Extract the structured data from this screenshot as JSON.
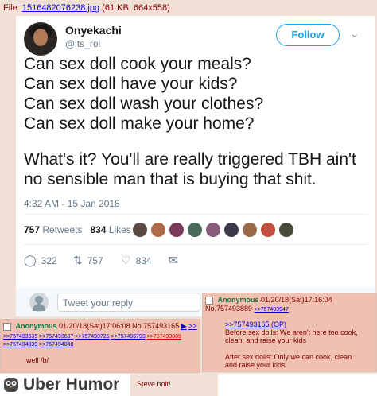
{
  "file_bar": {
    "prefix": "File:",
    "filename": "1516482076238.jpg",
    "info": "(61 KB, 664x558)"
  },
  "tweet": {
    "display_name": "Onyekachi",
    "handle": "@its_roi",
    "follow_label": "Follow",
    "lines": [
      "Can sex doll cook your meals?",
      "Can sex doll have your kids?",
      "Can sex doll wash your clothes?",
      "Can sex doll make your home?"
    ],
    "second_paragraph": "What's it? You'll are really triggered TBH ain't no sensible man that is buying that shit.",
    "timestamp": "4:32 AM - 15 Jan 2018",
    "retweets_count": "757",
    "retweets_label": "Retweets",
    "likes_count": "834",
    "likes_label": "Likes",
    "liker_avatar_colors": [
      "#5a4a42",
      "#b06a4a",
      "#7a3a5a",
      "#4a6a5a",
      "#8a5a7a",
      "#3a3a4a",
      "#9a6a4a",
      "#c05040",
      "#4a4a3a"
    ],
    "actions": {
      "reply_count": "322",
      "retweet_count": "757",
      "like_count": "834"
    },
    "reply_placeholder": "Tweet your reply"
  },
  "posts": [
    {
      "name": "Anonymous",
      "datetime": "01/20/18(Sat)17:06:08",
      "number": "No.757493165",
      "arrow": "▶",
      "backlink_first": ">>",
      "backlinks": [
        ">>757493635",
        ">>757493697",
        ">>757493725",
        ">>757493793",
        ">>757493889",
        ">>757494039",
        ">>757494048"
      ],
      "backlink_you": ">>757493889",
      "message": "well /b/"
    },
    {
      "name": "Anonymous",
      "datetime": "01/20/18(Sat)17:16:04",
      "number": "No.757493889",
      "backlink": ">>757493947",
      "quote": ">>757493165 (OP)",
      "para1": "Before sex dolls: We aren't here too cook, clean, and raise your kids",
      "para2": "After sex dolls: Only we can cook, clean and raise your kids"
    }
  ],
  "footer": {
    "brand": "Uber Humor",
    "caption": "Steve holt!"
  }
}
